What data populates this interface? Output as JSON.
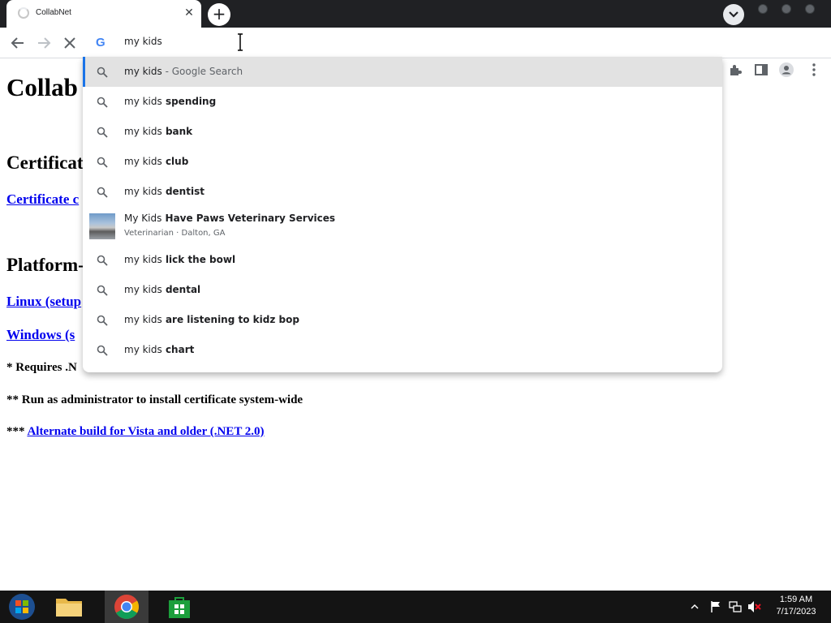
{
  "browser": {
    "tab": {
      "title": "CollabNet",
      "close_label": "✕"
    },
    "new_tab_label": "+",
    "omnibox": {
      "query": "my kids"
    }
  },
  "page": {
    "heading": "Collab",
    "sections": [
      {
        "heading": "Certificat"
      },
      {
        "heading": "Platform-"
      }
    ],
    "links": {
      "certificate": "Certificate c",
      "linux": "Linux (setup",
      "windows": "Windows (s",
      "alternate": "Alternate build for Vista and older (.NET 2.0)"
    },
    "notes": {
      "requires": "* Requires .N",
      "admin": "** Run as administrator to install certificate system-wide",
      "alternate_prefix": "***"
    }
  },
  "suggestions": [
    {
      "prefix": "my kids",
      "completion": "",
      "suffix": " - Google Search",
      "selected": true
    },
    {
      "prefix": "my kids",
      "completion": " spending"
    },
    {
      "prefix": "my kids",
      "completion": " bank"
    },
    {
      "prefix": "my kids",
      "completion": " club"
    },
    {
      "prefix": "my kids",
      "completion": " dentist"
    },
    {
      "prefix": "my kids",
      "completion": " lick the bowl"
    },
    {
      "prefix": "my kids",
      "completion": " dental"
    },
    {
      "prefix": "my kids",
      "completion": " are listening to kidz bop"
    },
    {
      "prefix": "my kids",
      "completion": " chart"
    }
  ],
  "place_suggestion": {
    "prefix": "My Kids",
    "completion": " Have Paws Veterinary Services",
    "detail": "Veterinarian · Dalton, GA"
  },
  "taskbar": {
    "time": "1:59 AM",
    "date": "7/17/2023"
  },
  "colors": {
    "tabstrip": "#202124",
    "link": "#0000ee",
    "selected_suggestion": "#e2e2e2",
    "selection_bar": "#1a73e8",
    "taskbar": "#141414"
  }
}
